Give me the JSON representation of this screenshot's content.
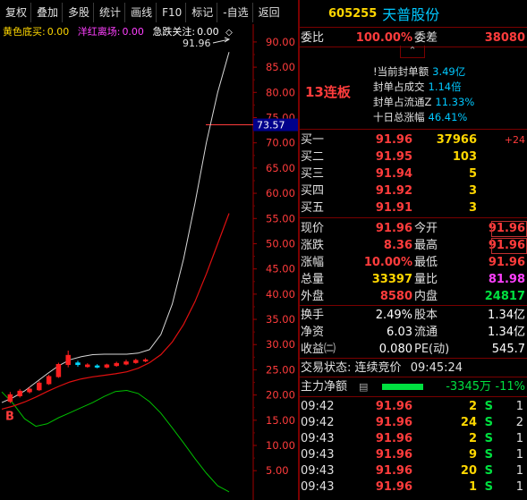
{
  "toolbar": {
    "items": [
      "复权",
      "叠加",
      "多股",
      "统计",
      "画线",
      "F10",
      "标记",
      "-自选",
      "返回"
    ]
  },
  "indicator": {
    "a_label": "黄色底买:",
    "a_value": "0.00",
    "b_label": "洋红离场:",
    "b_value": "0.00",
    "c_label": "急跌关注:",
    "c_value": "0.00",
    "diamond": "◇"
  },
  "chart_data": {
    "type": "line",
    "yticks": [
      "90.00",
      "85.00",
      "80.00",
      "75.00",
      "70.00",
      "65.00",
      "60.00",
      "55.00",
      "50.00",
      "45.00",
      "40.00",
      "35.00",
      "30.00",
      "25.00",
      "20.00",
      "15.00",
      "10.00",
      "5.00"
    ],
    "ylim": [
      0.78,
      93.0
    ],
    "price_tag": "73.57",
    "high_label": "91.96",
    "marker_b": "B",
    "upper_line": [
      [
        0.0,
        18.5
      ],
      [
        0.05,
        19.5
      ],
      [
        0.1,
        20.8
      ],
      [
        0.15,
        22.5
      ],
      [
        0.2,
        24.2
      ],
      [
        0.25,
        25.8
      ],
      [
        0.3,
        27.0
      ],
      [
        0.35,
        27.6
      ],
      [
        0.4,
        28.0
      ],
      [
        0.45,
        28.1
      ],
      [
        0.5,
        28.1
      ],
      [
        0.55,
        28.1
      ],
      [
        0.6,
        28.3
      ],
      [
        0.65,
        29.0
      ],
      [
        0.7,
        32.0
      ],
      [
        0.75,
        38.0
      ],
      [
        0.8,
        47.0
      ],
      [
        0.85,
        58.0
      ],
      [
        0.9,
        70.0
      ],
      [
        0.95,
        80.0
      ],
      [
        1.0,
        88.0
      ]
    ],
    "lower_line": [
      [
        0.0,
        17.2
      ],
      [
        0.05,
        17.8
      ],
      [
        0.1,
        18.6
      ],
      [
        0.15,
        19.6
      ],
      [
        0.2,
        20.7
      ],
      [
        0.25,
        21.7
      ],
      [
        0.3,
        22.6
      ],
      [
        0.35,
        23.2
      ],
      [
        0.4,
        23.6
      ],
      [
        0.45,
        23.9
      ],
      [
        0.5,
        24.2
      ],
      [
        0.55,
        24.6
      ],
      [
        0.6,
        25.3
      ],
      [
        0.65,
        26.4
      ],
      [
        0.7,
        28.0
      ],
      [
        0.75,
        30.5
      ],
      [
        0.8,
        34.0
      ],
      [
        0.85,
        38.5
      ],
      [
        0.9,
        44.0
      ],
      [
        0.95,
        50.0
      ],
      [
        1.0,
        56.0
      ]
    ],
    "green_line": [
      [
        0.0,
        20.6
      ],
      [
        0.05,
        18.3
      ],
      [
        0.1,
        15.3
      ],
      [
        0.15,
        13.8
      ],
      [
        0.2,
        14.3
      ],
      [
        0.25,
        15.5
      ],
      [
        0.3,
        16.5
      ],
      [
        0.35,
        17.5
      ],
      [
        0.4,
        18.5
      ],
      [
        0.45,
        19.7
      ],
      [
        0.5,
        20.7
      ],
      [
        0.55,
        20.9
      ],
      [
        0.6,
        20.3
      ],
      [
        0.65,
        18.7
      ],
      [
        0.7,
        16.4
      ],
      [
        0.75,
        13.5
      ],
      [
        0.8,
        10.5
      ],
      [
        0.85,
        7.4
      ],
      [
        0.9,
        4.5
      ],
      [
        0.95,
        2.0
      ],
      [
        1.0,
        0.8
      ]
    ],
    "candles": [
      {
        "x": 0.02,
        "o": 18.7,
        "c": 20.1,
        "h": 20.6,
        "l": 18.4,
        "up": true
      },
      {
        "x": 0.06,
        "o": 19.8,
        "c": 20.8,
        "h": 21.2,
        "l": 19.5,
        "up": true
      },
      {
        "x": 0.1,
        "o": 20.6,
        "c": 21.2,
        "h": 21.6,
        "l": 20.3,
        "up": true
      },
      {
        "x": 0.14,
        "o": 21.0,
        "c": 22.4,
        "h": 22.8,
        "l": 20.8,
        "up": true
      },
      {
        "x": 0.18,
        "o": 22.2,
        "c": 23.7,
        "h": 24.0,
        "l": 22.0,
        "up": true
      },
      {
        "x": 0.22,
        "o": 23.6,
        "c": 26.1,
        "h": 26.4,
        "l": 23.4,
        "up": true
      },
      {
        "x": 0.26,
        "o": 26.0,
        "c": 27.9,
        "h": 28.8,
        "l": 25.5,
        "up": true
      },
      {
        "x": 0.3,
        "o": 26.0,
        "c": 26.4,
        "h": 26.8,
        "l": 25.6,
        "up": false
      },
      {
        "x": 0.34,
        "o": 25.6,
        "c": 26.0,
        "h": 26.3,
        "l": 25.4,
        "up": true
      },
      {
        "x": 0.38,
        "o": 25.8,
        "c": 25.5,
        "h": 26.1,
        "l": 25.3,
        "up": false
      },
      {
        "x": 0.42,
        "o": 25.5,
        "c": 26.0,
        "h": 26.2,
        "l": 25.3,
        "up": true
      },
      {
        "x": 0.46,
        "o": 25.8,
        "c": 26.3,
        "h": 26.6,
        "l": 25.6,
        "up": true
      },
      {
        "x": 0.5,
        "o": 26.1,
        "c": 26.6,
        "h": 27.0,
        "l": 25.9,
        "up": true
      },
      {
        "x": 0.54,
        "o": 26.4,
        "c": 26.9,
        "h": 27.2,
        "l": 26.2,
        "up": true
      },
      {
        "x": 0.58,
        "o": 26.7,
        "c": 27.0,
        "h": 27.3,
        "l": 26.5,
        "up": true
      }
    ]
  },
  "panel": {
    "code": "605255",
    "name": "天普股份",
    "weibi_label": "委比",
    "weibi_value": "100.00%",
    "weicha_label": "委差",
    "weicha_value": "38080",
    "caret": "⌃",
    "lianban": "13连板",
    "stats": [
      {
        "label": "!当前封单额",
        "value": "3.49亿"
      },
      {
        "label": "封单占成交",
        "value": "1.14倍"
      },
      {
        "label": "封单占流通Z",
        "value": "11.33%"
      },
      {
        "label": "十日总涨幅",
        "value": "46.41%"
      }
    ],
    "bids": [
      {
        "label": "买一",
        "price": "91.96",
        "vol": "37966",
        "chg": "+24"
      },
      {
        "label": "买二",
        "price": "91.95",
        "vol": "103",
        "chg": ""
      },
      {
        "label": "买三",
        "price": "91.94",
        "vol": "5",
        "chg": ""
      },
      {
        "label": "买四",
        "price": "91.92",
        "vol": "3",
        "chg": ""
      },
      {
        "label": "买五",
        "price": "91.91",
        "vol": "3",
        "chg": ""
      }
    ],
    "quote": [
      {
        "l1": "现价",
        "v1": "91.96",
        "l2": "今开",
        "v2": "91.96"
      },
      {
        "l1": "涨跌",
        "v1": "8.36",
        "l2": "最高",
        "v2": "91.96"
      },
      {
        "l1": "涨幅",
        "v1": "10.00%",
        "l2": "最低",
        "v2": "91.96"
      },
      {
        "l1": "总量",
        "v1": "33397",
        "l2": "量比",
        "v2": "81.98"
      },
      {
        "l1": "外盘",
        "v1": "8580",
        "l2": "内盘",
        "v2": "24817"
      }
    ],
    "fund": [
      {
        "l1": "换手",
        "v1": "2.49%",
        "l2": "股本",
        "v2": "1.34亿"
      },
      {
        "l1": "净资",
        "v1": "6.03",
        "l2": "流通",
        "v2": "1.34亿"
      },
      {
        "l1": "收益㈡",
        "v1": "0.080",
        "l2": "PE(动)",
        "v2": "545.7"
      }
    ],
    "trade_status_label": "交易状态:",
    "trade_status": "连续竞价",
    "trade_time": "09:45:24",
    "main_flow_label": "主力净额",
    "main_flow_icon": "▤",
    "main_flow_value": "-3345万",
    "main_flow_pct": "-11%",
    "ticks": [
      {
        "time": "09:42",
        "price": "91.96",
        "vol": "2",
        "side": "S",
        "n": "1"
      },
      {
        "time": "09:42",
        "price": "91.96",
        "vol": "24",
        "side": "S",
        "n": "2"
      },
      {
        "time": "09:43",
        "price": "91.96",
        "vol": "2",
        "side": "S",
        "n": "1"
      },
      {
        "time": "09:43",
        "price": "91.96",
        "vol": "9",
        "side": "S",
        "n": "1"
      },
      {
        "time": "09:43",
        "price": "91.96",
        "vol": "20",
        "side": "S",
        "n": "1"
      },
      {
        "time": "09:43",
        "price": "91.96",
        "vol": "1",
        "side": "S",
        "n": "1"
      }
    ]
  }
}
